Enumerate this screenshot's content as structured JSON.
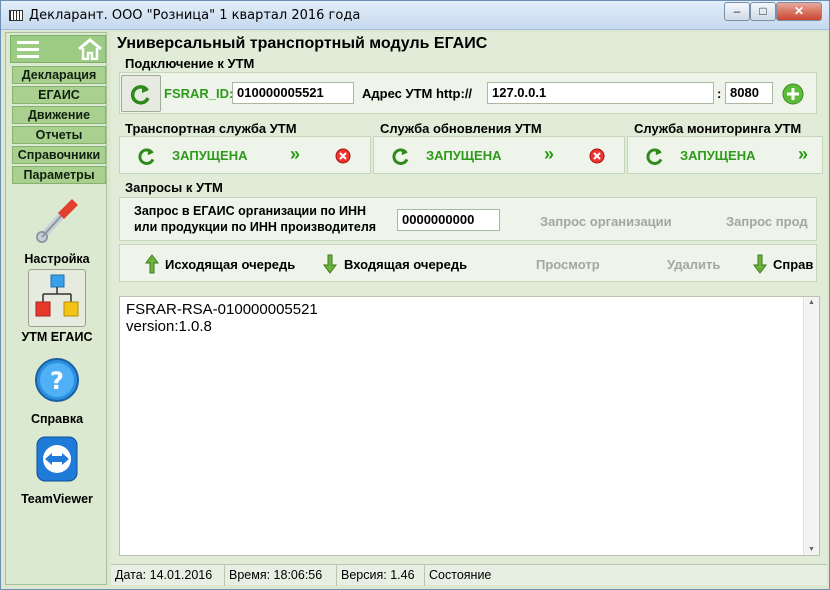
{
  "window": {
    "title": "Декларант. ООО \"Розница\" 1 квартал 2016 года",
    "controls": {
      "minimize": "–",
      "maximize": "□",
      "close": "✕"
    }
  },
  "sidebar": {
    "nav": [
      "Декларация",
      "ЕГАИС",
      "Движение",
      "Отчеты",
      "Справочники",
      "Параметры"
    ],
    "tools": [
      {
        "label": "Настройка",
        "icon": "wrench-icon"
      },
      {
        "label": "УТМ ЕГАИС",
        "icon": "network-diagram-icon",
        "selected": true
      },
      {
        "label": "Справка",
        "icon": "help-icon"
      },
      {
        "label": "TeamViewer",
        "icon": "teamviewer-icon"
      }
    ]
  },
  "main": {
    "title": "Универсальный транспортный модуль ЕГАИС",
    "connection": {
      "section_title": "Подключение к УТМ",
      "fsrar_label": "FSRAR_ID:",
      "fsrar_value": "010000005521",
      "address_label": "Адрес УТМ http://",
      "address_value": "127.0.0.1",
      "port_separator": ":",
      "port_value": "8080"
    },
    "services": [
      {
        "title": "Транспортная служба УТМ",
        "status": "ЗАПУЩЕНА"
      },
      {
        "title": "Служба обновления УТМ",
        "status": "ЗАПУЩЕНА"
      },
      {
        "title": "Служба мониторинга УТМ",
        "status": "ЗАПУЩЕНА"
      }
    ],
    "requests": {
      "section_title": "Запросы к УТМ",
      "query_label_1": "Запрос в ЕГАИС организации по ИНН",
      "query_label_2": "или продукции по ИНН производителя",
      "inn_value": "0000000000",
      "org_request": "Запрос организации",
      "prod_request": "Запрос прод"
    },
    "queue": {
      "outgoing": "Исходящая очередь",
      "incoming": "Входящая очередь",
      "view": "Просмотр",
      "delete": "Удалить",
      "ref": "Справ"
    },
    "output": {
      "line1": "FSRAR-RSA-010000005521",
      "line2": "version:1.0.8"
    }
  },
  "status": {
    "date": "Дата: 14.01.2016",
    "time": "Время: 18:06:56",
    "version": "Версия: 1.46",
    "state": "Состояние"
  },
  "colors": {
    "accent_green": "#2e9a1a",
    "nav_bg": "#a9d08f",
    "panel_bg": "#eef4e9"
  }
}
